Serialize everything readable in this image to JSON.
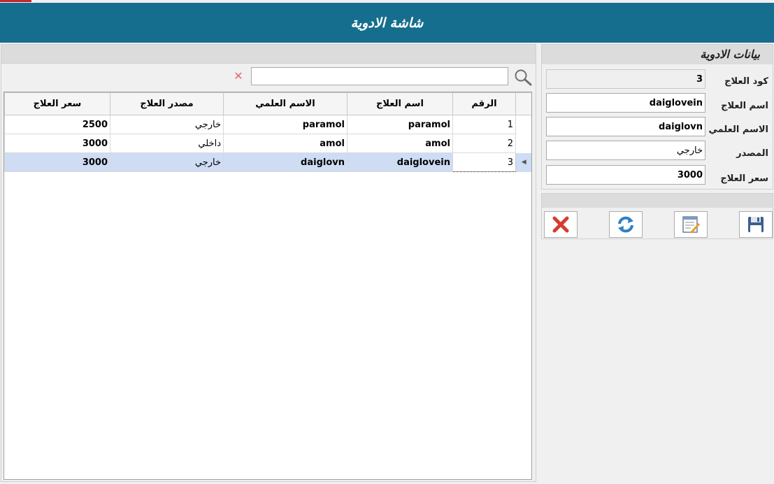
{
  "window": {
    "title": "شاشة الادوية"
  },
  "search": {
    "value": "",
    "clear_symbol": "✕"
  },
  "grid": {
    "columns": [
      "الرقم",
      "اسم العلاج",
      "الاسم العلمي",
      "مصدر العلاج",
      "سعر العلاج"
    ],
    "rows": [
      {
        "id": "1",
        "name": "paramol",
        "scientific": "paramol",
        "source": "خارجي",
        "price": "2500"
      },
      {
        "id": "2",
        "name": "amol",
        "scientific": "amol",
        "source": "داخلي",
        "price": "3000"
      },
      {
        "id": "3",
        "name": "daiglovein",
        "scientific": "daiglovn",
        "source": "خارجي",
        "price": "3000"
      }
    ],
    "selected_row": 3
  },
  "details": {
    "title": "بيانات الادوية",
    "fields": {
      "code": {
        "label": "كود العلاج",
        "value": "3"
      },
      "name": {
        "label": "اسم العلاج",
        "value": "daiglovein"
      },
      "scientific": {
        "label": "الاسم العلمي",
        "value": "daiglovn"
      },
      "source": {
        "label": "المصدر",
        "value": "خارجي"
      },
      "price": {
        "label": "سعر العلاج",
        "value": "3000"
      }
    }
  },
  "toolbar": {
    "buttons": [
      {
        "icon": "delete-icon"
      },
      {
        "icon": "refresh-icon"
      },
      {
        "icon": "edit-icon"
      },
      {
        "icon": "save-icon"
      }
    ]
  },
  "colors": {
    "header": "#166e8e",
    "selection": "#cedcf4",
    "accent_red": "#c0282d"
  }
}
